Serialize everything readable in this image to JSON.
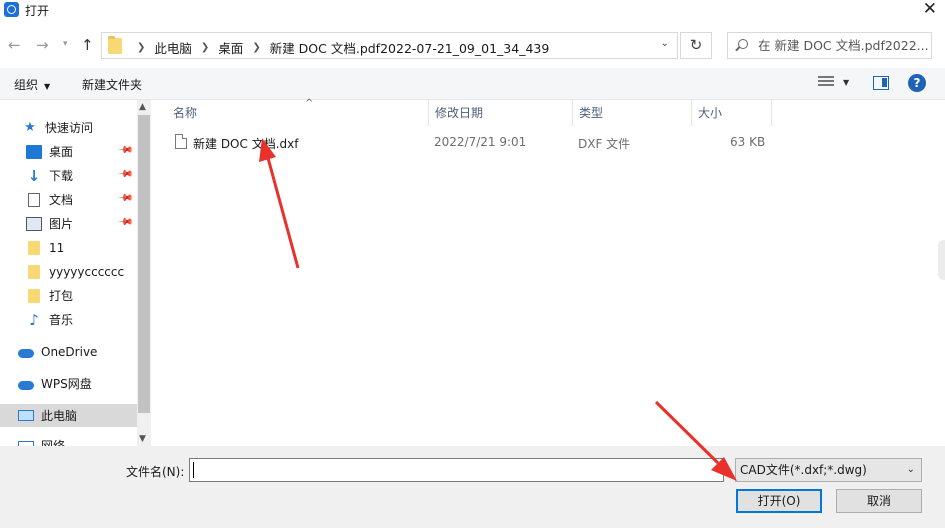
{
  "window": {
    "title": "打开",
    "close_glyph": "✕"
  },
  "address_bar": {
    "breadcrumbs": [
      "此电脑",
      "桌面",
      "新建 DOC 文档.pdf2022-07-21_09_01_34_439"
    ],
    "search_placeholder": "在 新建 DOC 文档.pdf2022..."
  },
  "toolbar": {
    "organize_label": "组织",
    "new_folder_label": "新建文件夹",
    "help_glyph": "?"
  },
  "nav_pane": {
    "items": [
      {
        "label": "快速访问",
        "icon": "star-icon"
      },
      {
        "label": "桌面",
        "icon": "desktop-icon",
        "pinned": true
      },
      {
        "label": "下载",
        "icon": "download-icon",
        "pinned": true
      },
      {
        "label": "文档",
        "icon": "document-icon",
        "pinned": true
      },
      {
        "label": "图片",
        "icon": "pictures-icon",
        "pinned": true
      },
      {
        "label": "11",
        "icon": "folder-icon"
      },
      {
        "label": "yyyyycccccc",
        "icon": "folder-icon"
      },
      {
        "label": "打包",
        "icon": "folder-icon"
      },
      {
        "label": "音乐",
        "icon": "music-icon"
      },
      {
        "label": "OneDrive",
        "icon": "cloud-icon"
      },
      {
        "label": "WPS网盘",
        "icon": "cloud-icon"
      },
      {
        "label": "此电脑",
        "icon": "computer-icon",
        "selected": true
      },
      {
        "label": "网络",
        "icon": "network-icon"
      }
    ]
  },
  "file_list": {
    "columns": [
      "名称",
      "修改日期",
      "类型",
      "大小"
    ],
    "rows": [
      {
        "name": "新建 DOC 文档.dxf",
        "modified": "2022/7/21 9:01",
        "type": "DXF 文件",
        "size": "63 KB"
      }
    ]
  },
  "bottom": {
    "filename_label": "文件名(N):",
    "filename_value": "",
    "filetype_selected": "CAD文件(*.dxf;*.dwg)",
    "open_label": "打开(O)",
    "cancel_label": "取消"
  },
  "colors": {
    "accent": "#0078d7",
    "annotation_arrow": "#e8312a"
  }
}
